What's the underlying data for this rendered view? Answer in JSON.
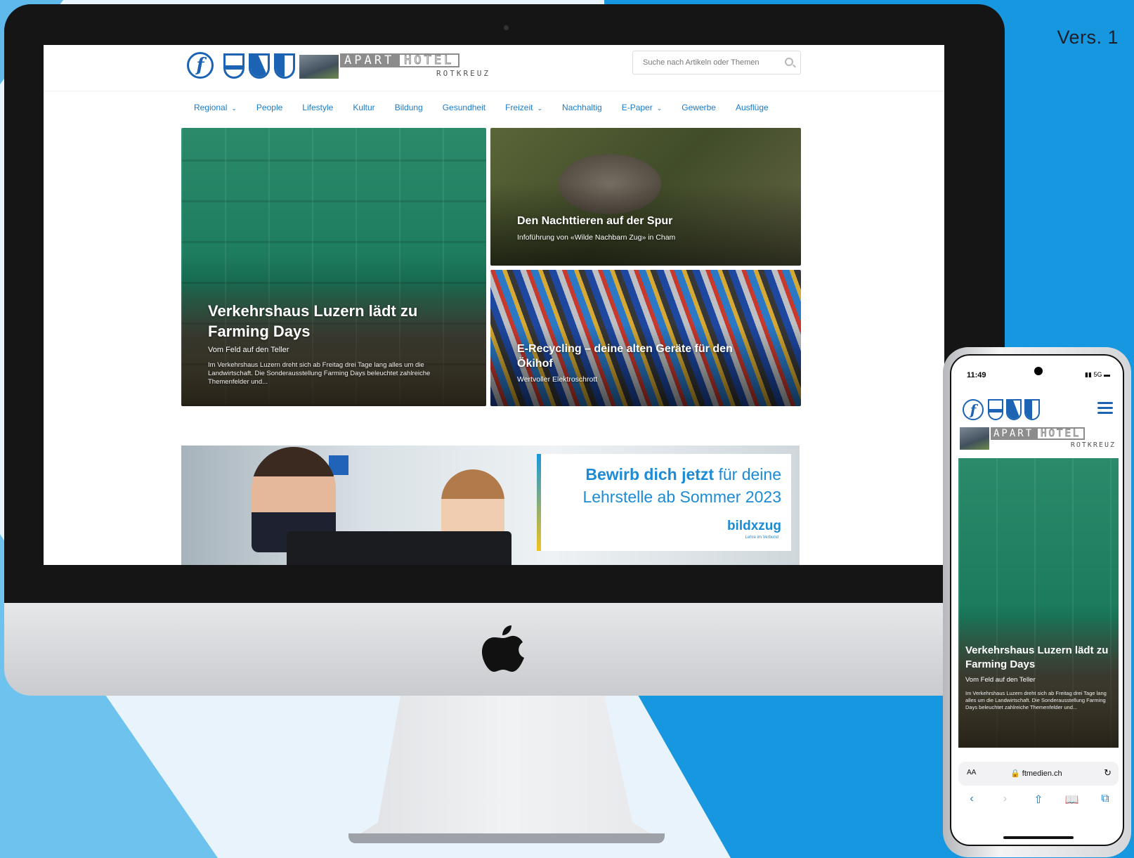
{
  "version_label": "Vers. 1",
  "site": {
    "logo_letter": "f",
    "hotel_brand": {
      "apart": "APART",
      "hotel": "HOTEL",
      "location": "ROTKREUZ"
    },
    "search": {
      "placeholder": "Suche nach Artikeln oder Themen",
      "icon": "search-icon"
    },
    "nav": [
      {
        "label": "Regional",
        "has_dropdown": true
      },
      {
        "label": "People",
        "has_dropdown": false
      },
      {
        "label": "Lifestyle",
        "has_dropdown": false
      },
      {
        "label": "Kultur",
        "has_dropdown": false
      },
      {
        "label": "Bildung",
        "has_dropdown": false
      },
      {
        "label": "Gesundheit",
        "has_dropdown": false
      },
      {
        "label": "Freizeit",
        "has_dropdown": true
      },
      {
        "label": "Nachhaltig",
        "has_dropdown": false
      },
      {
        "label": "E-Paper",
        "has_dropdown": true
      },
      {
        "label": "Gewerbe",
        "has_dropdown": false
      },
      {
        "label": "Ausflüge",
        "has_dropdown": false
      }
    ],
    "hero": {
      "main": {
        "title": "Verkehrshaus Luzern lädt zu Farming Days",
        "subtitle": "Vom Feld auf den Teller",
        "excerpt": "Im Verkehrshaus Luzern dreht sich ab Freitag drei Tage lang alles um die Landwirtschaft. Die Sonderausstellung Farming Days beleuchtet zahlreiche Themenfelder und..."
      },
      "side_top": {
        "title": "Den Nachttieren auf der Spur",
        "subtitle": "Infoführung von «Wilde Nachbarn Zug» in Cham"
      },
      "side_bottom": {
        "title": "E-Recycling – deine alten Geräte für den Ökihof",
        "subtitle": "Wertvoller Elektroschrott"
      }
    },
    "ad": {
      "line1_bold": "Bewirb dich jetzt",
      "line1_rest": " für deine",
      "line2": "Lehrstelle ab Sommer 2023",
      "brand": "bildxzug",
      "tagline": "Lehre im Verbund"
    }
  },
  "phone": {
    "time": "11:49",
    "status": "5G",
    "hero": {
      "title": "Verkehrshaus Luzern lädt zu Farming Days",
      "subtitle": "Vom Feld auf den Teller",
      "excerpt": "Im Verkehrshaus Luzern dreht sich ab Freitag drei Tage lang alles um die Landwirtschaft. Die Sonderausstellung Farming Days beleuchtet zahlreiche Themenfelder und..."
    },
    "browser": {
      "aa": "AA",
      "url": "ftmedien.ch"
    }
  },
  "colors": {
    "brand_blue": "#1c64b3",
    "link_blue": "#1a7bc9",
    "background_blue": "#1697df",
    "ad_blue": "#1c8bd6"
  }
}
